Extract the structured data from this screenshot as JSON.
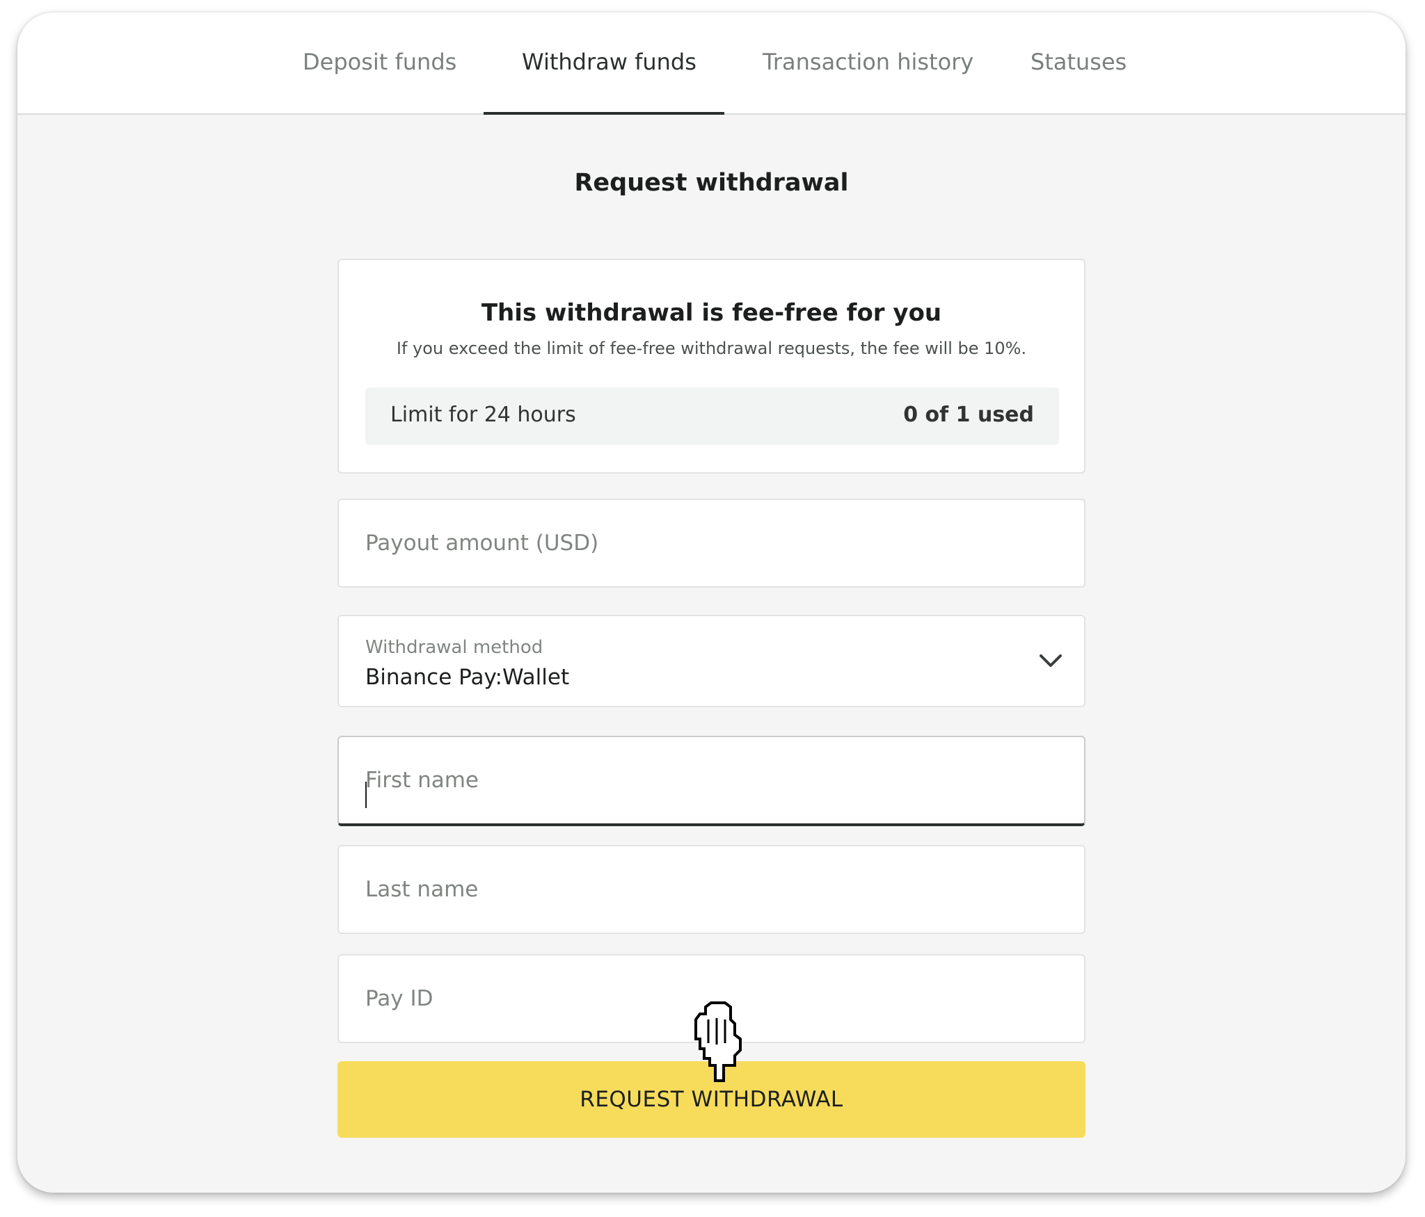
{
  "tabs": [
    {
      "label": "Deposit funds",
      "active": false
    },
    {
      "label": "Withdraw funds",
      "active": true
    },
    {
      "label": "Transaction history",
      "active": false
    },
    {
      "label": "Statuses",
      "active": false
    }
  ],
  "page": {
    "heading": "Request withdrawal"
  },
  "fee_card": {
    "title": "This withdrawal is fee-free for you",
    "subtitle": "If you exceed the limit of fee-free withdrawal requests, the fee will be 10%.",
    "limit_label": "Limit for 24 hours",
    "limit_value": "0 of 1 used"
  },
  "form": {
    "payout_amount": {
      "placeholder": "Payout amount (USD)",
      "value": ""
    },
    "withdrawal_method": {
      "label": "Withdrawal method",
      "value": "Binance Pay:Wallet"
    },
    "first_name": {
      "placeholder": "First name",
      "value": ""
    },
    "last_name": {
      "placeholder": "Last name",
      "value": ""
    },
    "pay_id": {
      "placeholder": "Pay ID",
      "value": ""
    },
    "submit_label": "REQUEST WITHDRAWAL"
  },
  "icons": {
    "dropdown": "chevron-down-icon",
    "cursor": "hand-pointer-icon"
  },
  "colors": {
    "accent": "#f7dc5c",
    "active_tab": "#2b2f2d",
    "background": "#f4f5f4"
  }
}
